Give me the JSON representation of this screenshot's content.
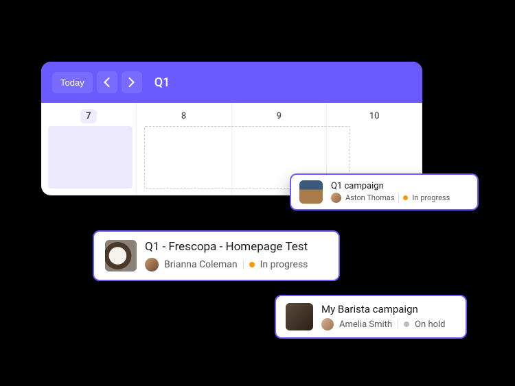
{
  "colors": {
    "primary": "#6b5bff",
    "primary_light": "#7a6bff",
    "status_in_progress": "#ff9500",
    "status_on_hold": "#bbbbbb"
  },
  "calendar": {
    "today_label": "Today",
    "period_title": "Q1",
    "days": [
      {
        "number": "7",
        "selected": true
      },
      {
        "number": "8",
        "selected": false
      },
      {
        "number": "9",
        "selected": false
      },
      {
        "number": "10",
        "selected": false
      }
    ]
  },
  "cards": [
    {
      "title": "Q1 campaign",
      "thumb_icon": "landscape-thumb",
      "owner": "Aston Thomas",
      "status_label": "In progress",
      "status_color": "orange"
    },
    {
      "title": "Q1 - Frescopa - Homepage Test",
      "thumb_icon": "espresso-thumb",
      "owner": "Brianna Coleman",
      "status_label": "In progress",
      "status_color": "orange"
    },
    {
      "title": "My Barista campaign",
      "thumb_icon": "barista-thumb",
      "owner": "Amelia Smith",
      "status_label": "On hold",
      "status_color": "gray"
    }
  ]
}
